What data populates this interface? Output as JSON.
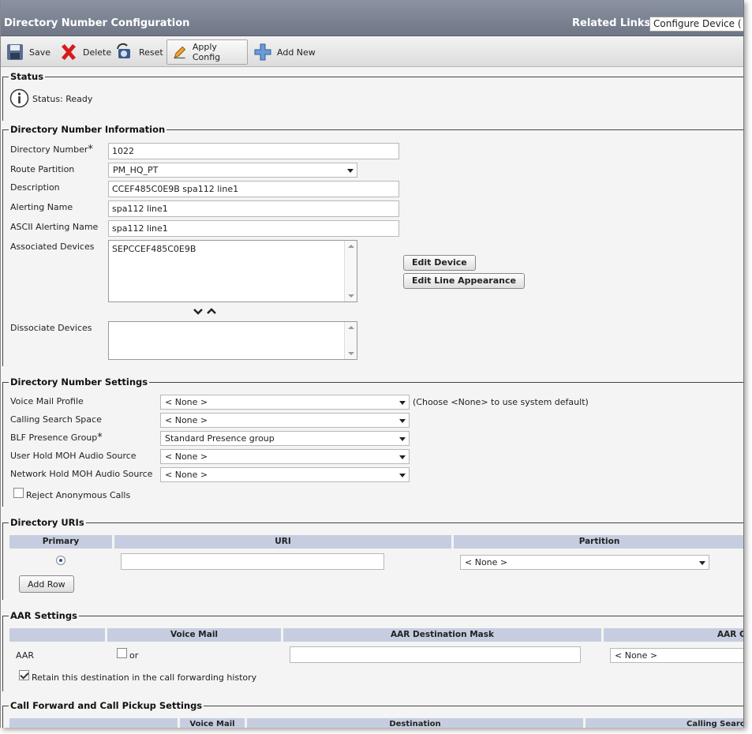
{
  "header": {
    "title": "Directory Number Configuration",
    "related_links_label": "Related Links:",
    "related_links_value": "Configure Device ("
  },
  "toolbar": {
    "save": "Save",
    "delete": "Delete",
    "reset": "Reset",
    "apply_config": "Apply Config",
    "add_new": "Add New"
  },
  "status": {
    "legend": "Status",
    "text": "Status: Ready"
  },
  "dn_info": {
    "legend": "Directory Number Information",
    "directory_number_label": "Directory Number",
    "required_mark": "*",
    "directory_number_value": "1022",
    "route_partition_label": "Route Partition",
    "route_partition_value": "PM_HQ_PT",
    "description_label": "Description",
    "description_value": "CCEF485C0E9B spa112 line1",
    "alerting_name_label": "Alerting Name",
    "alerting_name_value": "spa112 line1",
    "ascii_alerting_name_label": "ASCII Alerting Name",
    "ascii_alerting_name_value": "spa112 line1",
    "associated_devices_label": "Associated Devices",
    "associated_devices_items": [
      "SEPCCEF485C0E9B"
    ],
    "edit_device": "Edit Device",
    "edit_line_appearance": "Edit Line Appearance",
    "dissociate_devices_label": "Dissociate Devices"
  },
  "dn_settings": {
    "legend": "Directory Number Settings",
    "voice_mail_profile_label": "Voice Mail Profile",
    "voice_mail_profile_value": "< None >",
    "voice_mail_hint": "(Choose <None> to use system default)",
    "css_label": "Calling Search Space",
    "css_value": "< None >",
    "blf_label": "BLF Presence Group",
    "required_mark": "*",
    "blf_value": "Standard Presence group",
    "user_hold_label": "User Hold MOH Audio Source",
    "user_hold_value": "< None >",
    "network_hold_label": "Network Hold MOH Audio Source",
    "network_hold_value": "< None >",
    "reject_anonymous_label": "Reject Anonymous Calls"
  },
  "uris": {
    "legend": "Directory URIs",
    "col_primary": "Primary",
    "col_uri": "URI",
    "col_partition": "Partition",
    "row_uri_value": "",
    "row_partition_value": "< None >",
    "add_row": "Add Row"
  },
  "aar": {
    "legend": "AAR Settings",
    "col_voice_mail": "Voice Mail",
    "col_aar_mask": "AAR Destination Mask",
    "col_aar_group": "AAR G",
    "row_label": "AAR",
    "or_label": "or",
    "group_value": "< None >",
    "retain_label": "Retain this destination in the call forwarding history"
  },
  "call_forward": {
    "legend": "Call Forward and Call Pickup Settings",
    "col_voice_mail": "Voice Mail",
    "col_destination": "Destination",
    "col_css": "Calling Search"
  }
}
